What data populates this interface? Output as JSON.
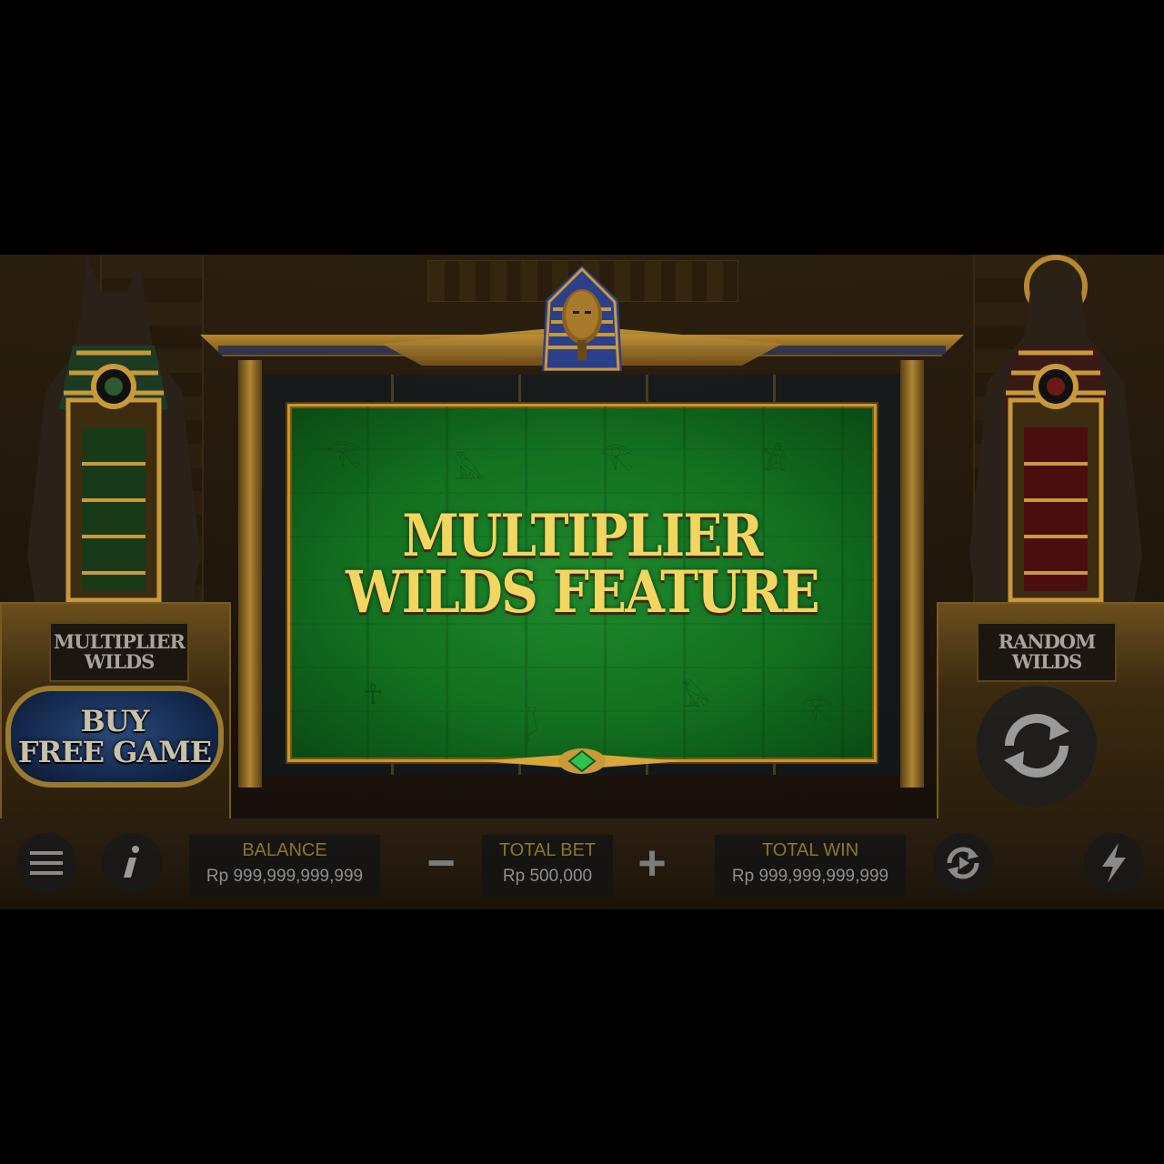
{
  "game": {
    "popup": {
      "line1": "MULTIPLIER",
      "line2": "WILDS FEATURE"
    },
    "left_plaque": {
      "line1": "MULTIPLIER",
      "line2": "WILDS"
    },
    "right_plaque": {
      "line1": "RANDOM",
      "line2": "WILDS"
    },
    "buy_button": {
      "line1": "BUY",
      "line2": "FREE GAME"
    }
  },
  "bottom_bar": {
    "balance_label": "BALANCE",
    "balance_value": "Rp 999,999,999,999",
    "total_bet_label": "TOTAL BET",
    "total_bet_value": "Rp 500,000",
    "total_win_label": "TOTAL WIN",
    "total_win_value": "Rp 999,999,999,999",
    "minus_label": "−",
    "plus_label": "+"
  },
  "icons": [
    "menu-icon",
    "info-icon",
    "autoplay-icon",
    "turbo-icon",
    "spin-icon"
  ],
  "colors": {
    "gold_text": "#f2d660",
    "popup_green": "#137020",
    "label_gold": "#8c7620"
  }
}
